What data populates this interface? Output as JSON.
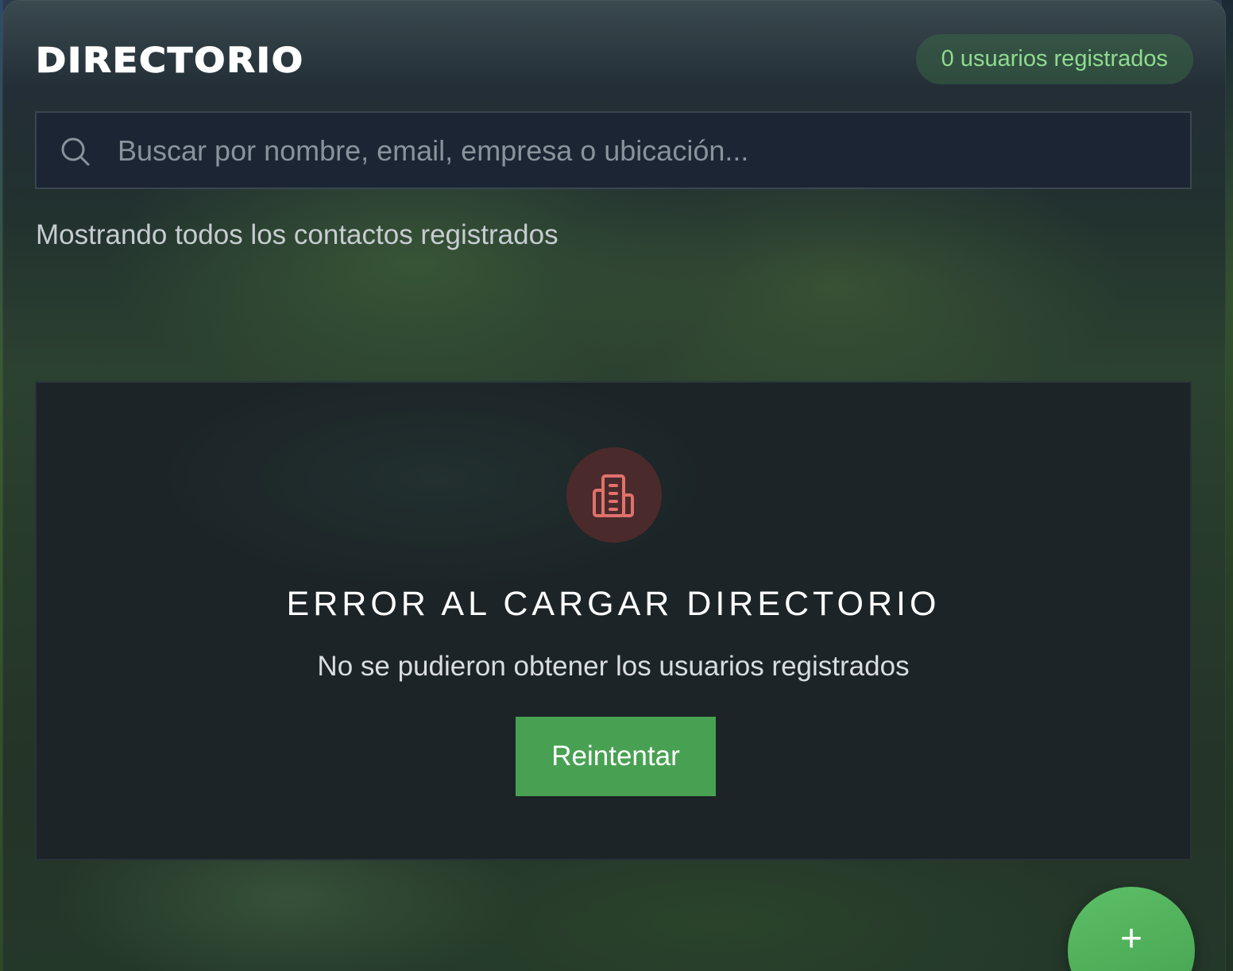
{
  "header": {
    "title": "DIRECTORIO",
    "user_count_badge": "0 usuarios registrados"
  },
  "search": {
    "icon": "search-icon",
    "placeholder": "Buscar por nombre, email, empresa o ubicación...",
    "value": ""
  },
  "results_summary": "Mostrando todos los contactos registrados",
  "error_state": {
    "icon": "building-icon",
    "title": "ERROR AL CARGAR DIRECTORIO",
    "message": "No se pudieron obtener los usuarios registrados",
    "retry_label": "Reintentar"
  },
  "fab": {
    "icon": "plus-icon",
    "label": "+"
  },
  "colors": {
    "accent_green": "#48a152",
    "badge_text": "#8fdc8f",
    "error_icon": "#e0716c",
    "error_icon_bg": "#4b2a2c"
  }
}
